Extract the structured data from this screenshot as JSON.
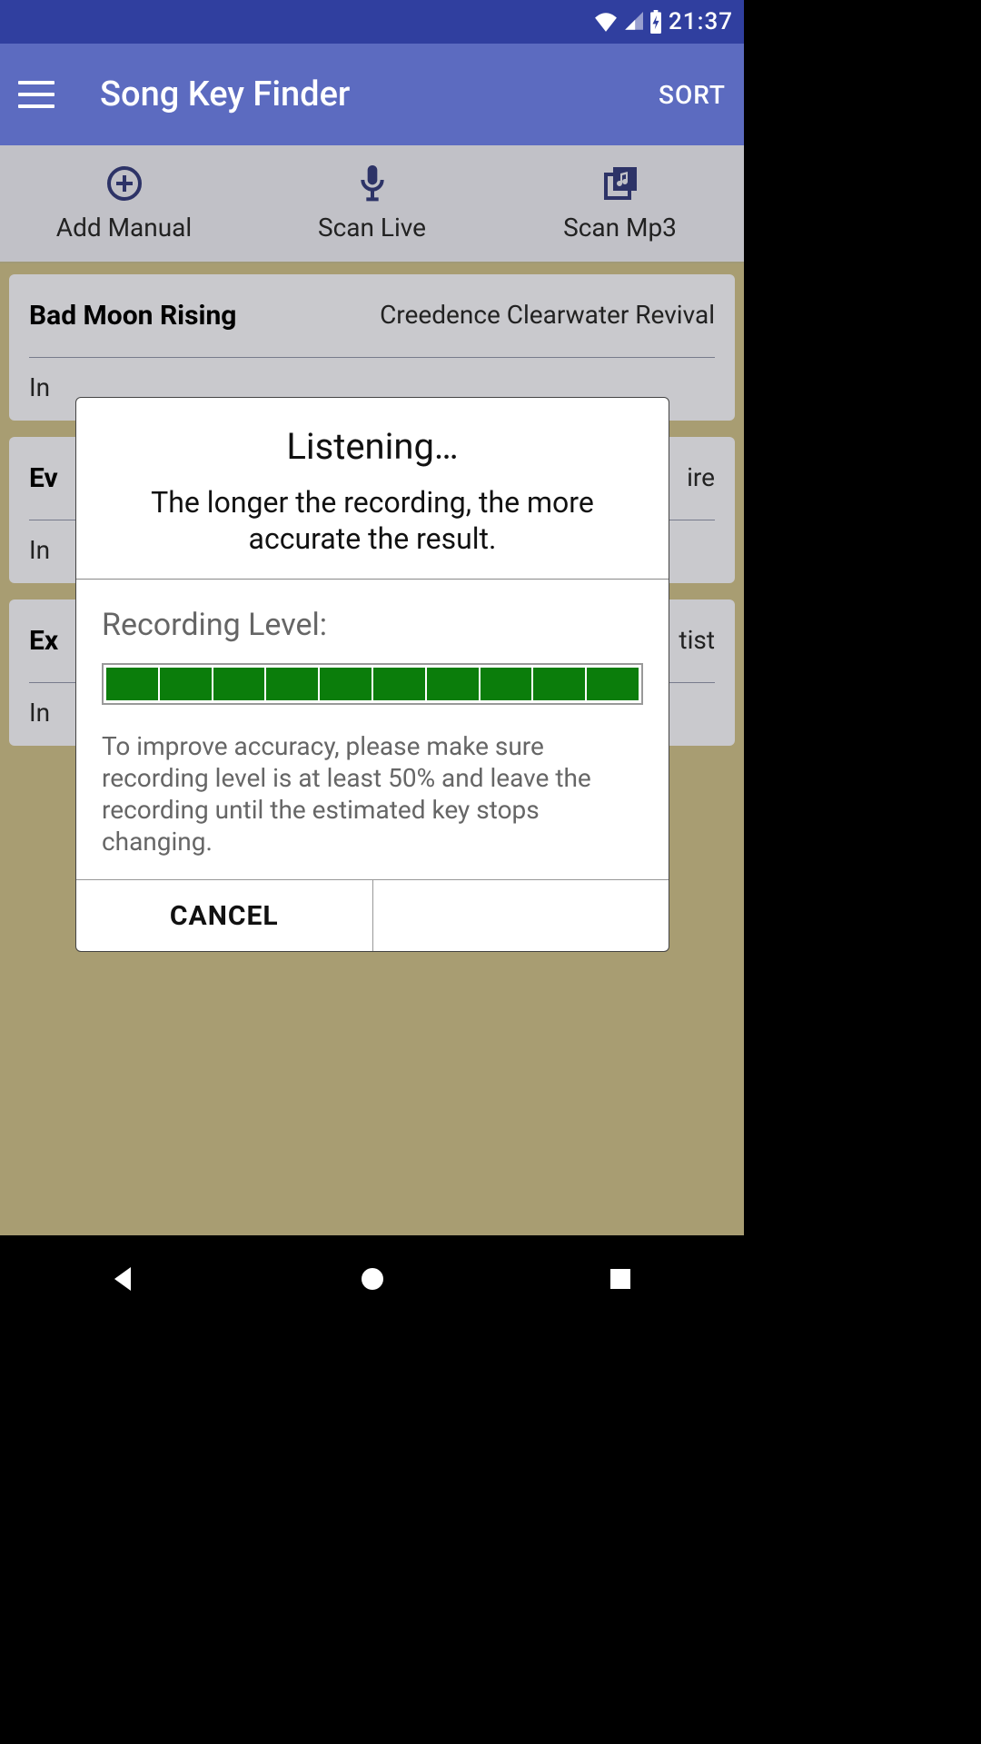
{
  "status_bar": {
    "time": "21:37"
  },
  "app_bar": {
    "title": "Song Key Finder",
    "sort": "SORT"
  },
  "actions": {
    "add_manual": "Add Manual",
    "scan_live": "Scan Live",
    "scan_mp3": "Scan Mp3"
  },
  "songs": [
    {
      "title": "Bad Moon Rising",
      "artist": "Creedence Clearwater Revival",
      "key_prefix": "In"
    },
    {
      "title": "Ev",
      "artist": "ire",
      "key_prefix": "In"
    },
    {
      "title": "Ex",
      "artist": "tist",
      "key_prefix": "In"
    }
  ],
  "dialog": {
    "title": "Listening…",
    "subtitle": "The longer the recording, the more accurate the result.",
    "recording_label": "Recording Level:",
    "level_segments": 10,
    "level_filled": 10,
    "hint": "To improve accuracy, please make sure recording level is at least 50% and leave the recording until the estimated key stops changing.",
    "cancel": "CANCEL"
  }
}
